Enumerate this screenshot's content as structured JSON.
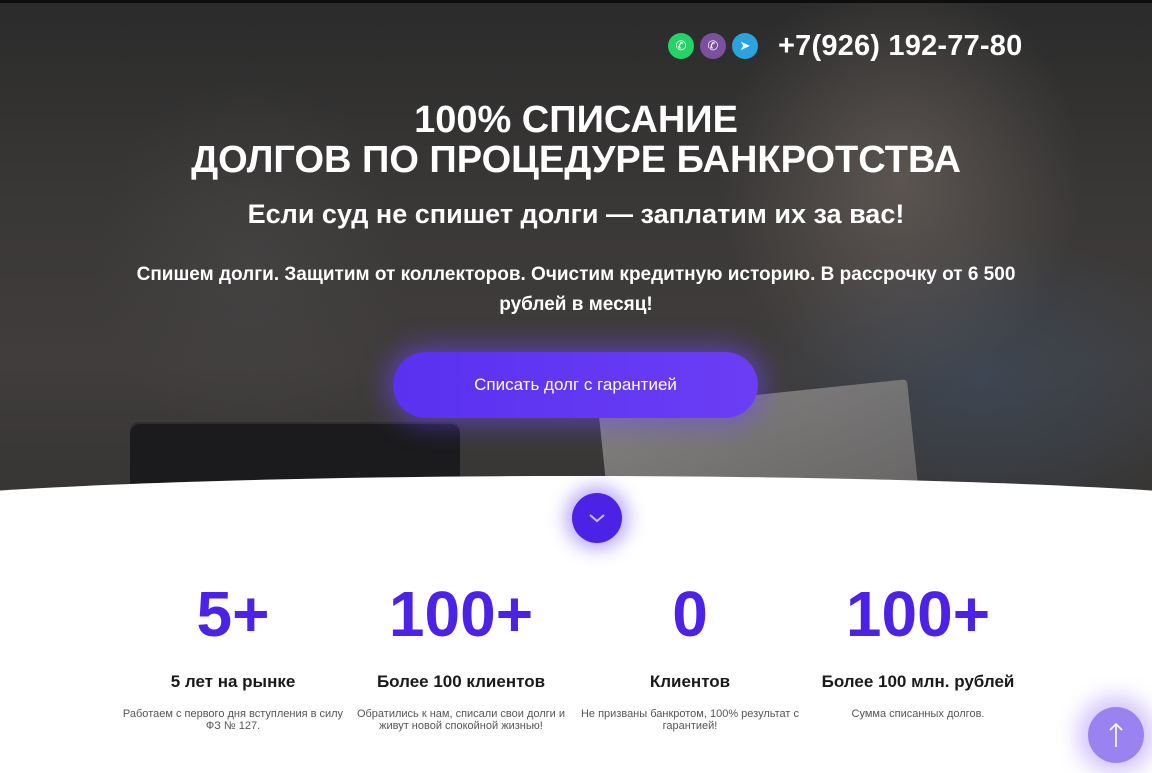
{
  "header": {
    "phone": "+7(926) 192-77-80",
    "messengers": [
      {
        "icon": "whatsapp-icon",
        "color": "#25d366",
        "glyph": "✆"
      },
      {
        "icon": "viber-icon",
        "color": "#7b519d",
        "glyph": "✆"
      },
      {
        "icon": "telegram-icon",
        "color": "#2aa3df",
        "glyph": "➤"
      }
    ]
  },
  "hero": {
    "title_line1": "100% СПИСАНИЕ",
    "title_line2": "ДОЛГОВ ПО ПРОЦЕДУРЕ БАНКРОТСТВА",
    "subtitle": "Если суд не спишет долги — заплатим их за вас!",
    "lead": "Спишем долги. Защитим от коллекторов. Очистим кредитную историю. В рассрочку от 6 500 рублей в месяц!",
    "cta_label": "Списать долг с гарантией"
  },
  "stats": [
    {
      "value": "5+",
      "title": "5 лет на рынке",
      "desc": "Работаем с первого дня вступления в силу ФЗ № 127."
    },
    {
      "value": "100+",
      "title": "Более 100 клиентов",
      "desc": "Обратились к нам, списали свои долги и живут новой спокойной жизнью!"
    },
    {
      "value": "0",
      "title": "Клиентов",
      "desc": "Не призваны банкротом, 100% результат с гарантией!"
    },
    {
      "value": "100+",
      "title": "Более 100 млн. рублей",
      "desc": "Сумма списанных долгов."
    }
  ],
  "colors": {
    "accent": "#4b22e6",
    "button": "#5a31f0",
    "to_top": "#9a83f0"
  }
}
